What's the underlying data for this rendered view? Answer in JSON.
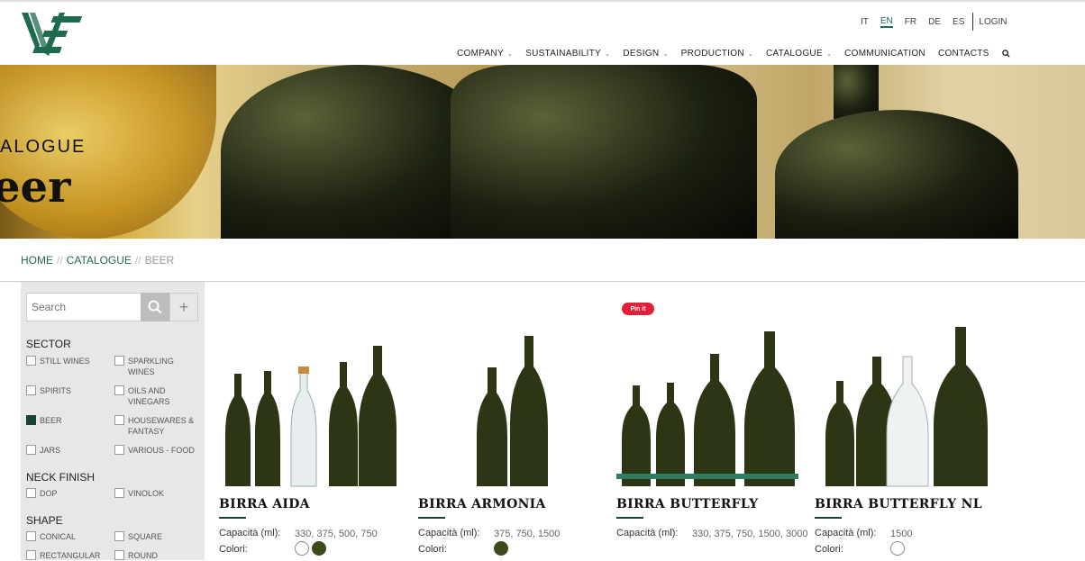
{
  "header": {
    "languages": [
      "IT",
      "EN",
      "FR",
      "DE",
      "ES"
    ],
    "active_language": "EN",
    "login_label": "LOGIN",
    "nav": [
      {
        "label": "COMPANY",
        "has_dropdown": true
      },
      {
        "label": "SUSTAINABILITY",
        "has_dropdown": true
      },
      {
        "label": "DESIGN",
        "has_dropdown": true
      },
      {
        "label": "PRODUCTION",
        "has_dropdown": true
      },
      {
        "label": "CATALOGUE",
        "has_dropdown": true
      },
      {
        "label": "COMMUNICATION",
        "has_dropdown": false
      },
      {
        "label": "CONTACTS",
        "has_dropdown": false
      }
    ]
  },
  "hero": {
    "category_text": "ALOGUE",
    "title_text": "eer"
  },
  "breadcrumb": {
    "home": "HOME",
    "catalogue": "CATALOGUE",
    "current": "BEER",
    "separator": "//"
  },
  "sidebar": {
    "search_placeholder": "Search",
    "plus_symbol": "+",
    "sector_title": "SECTOR",
    "sector_options": [
      {
        "label": "STILL WINES",
        "checked": false
      },
      {
        "label": "SPARKLING WINES",
        "checked": false
      },
      {
        "label": "SPIRITS",
        "checked": false
      },
      {
        "label": "OILS AND VINEGARS",
        "checked": false
      },
      {
        "label": "BEER",
        "checked": true
      },
      {
        "label": "HOUSEWARES & FANTASY",
        "checked": false
      },
      {
        "label": "JARS",
        "checked": false
      },
      {
        "label": "VARIOUS - FOOD",
        "checked": false
      }
    ],
    "neck_title": "NECK FINISH",
    "neck_options": [
      {
        "label": "DOP",
        "checked": false
      },
      {
        "label": "VINOLOK",
        "checked": false
      }
    ],
    "shape_title": "SHAPE",
    "shape_options": [
      {
        "label": "CONICAL",
        "checked": false
      },
      {
        "label": "SQUARE",
        "checked": false
      },
      {
        "label": "RECTANGULAR",
        "checked": false
      },
      {
        "label": "ROUND",
        "checked": false
      }
    ]
  },
  "pin_badge": "Pin it",
  "products": [
    {
      "name": "BIRRA AIDA",
      "capacity_label": "Capacità (ml):",
      "capacity_value": "330, 375, 500, 750",
      "colors_label": "Colori:",
      "colors": [
        "#ffffff",
        "#3d4a1c"
      ]
    },
    {
      "name": "BIRRA ARMONIA",
      "capacity_label": "Capacità (ml):",
      "capacity_value": "375, 750, 1500",
      "colors_label": "Colori:",
      "colors": [
        "#3d4a1c"
      ]
    },
    {
      "name": "BIRRA BUTTERFLY",
      "capacity_label": "Capacità (ml):",
      "capacity_value": "330, 375, 750, 1500, 3000",
      "colors_label": "",
      "colors": []
    },
    {
      "name": "BIRRA BUTTERFLY NL",
      "capacity_label": "Capacità (ml):",
      "capacity_value": "1500",
      "colors_label": "Colori:",
      "colors": [
        "#ffffff"
      ]
    }
  ],
  "colors": {
    "brand_green": "#1f6b4d",
    "dark_green": "#16432f",
    "bottle_dark": "#3d4a1c"
  }
}
